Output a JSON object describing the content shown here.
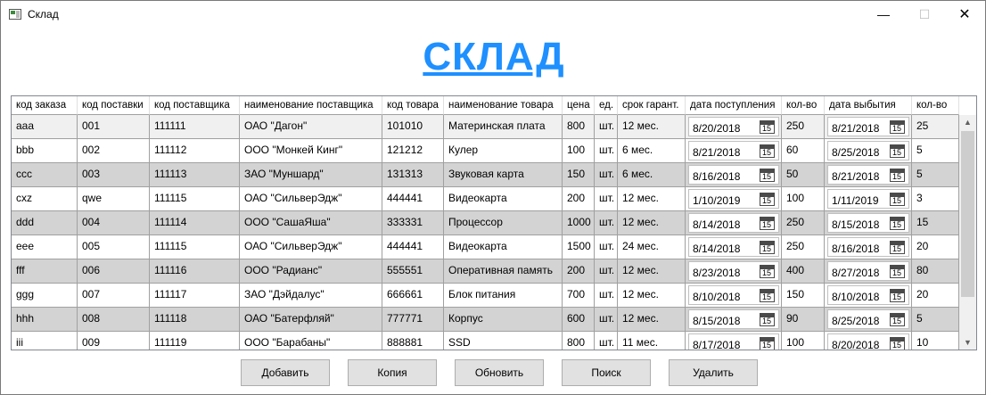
{
  "window": {
    "title": "Склад",
    "minimize_icon": "minimize-icon",
    "maximize_icon": "maximize-icon",
    "close_icon": "close-icon",
    "min_glyph": "—",
    "max_glyph": "☐",
    "close_glyph": "✕"
  },
  "heading": "СКЛАД",
  "grid": {
    "columns": [
      "код заказа",
      "код поставки",
      "код поставщика",
      "наименование поставщика",
      "код товара",
      "наименование товара",
      "цена",
      "ед.",
      "срок гарант.",
      "дата поступления",
      "кол-во",
      "дата выбытия",
      "кол-во"
    ],
    "calendar_icon_text": "15",
    "rows": [
      [
        "aaa",
        "001",
        "111111",
        "ОАО \"Дагон\"",
        "101010",
        "Материнская плата",
        "800",
        "шт.",
        "12 мес.",
        "8/20/2018",
        "250",
        "8/21/2018",
        "25"
      ],
      [
        "bbb",
        "002",
        "111112",
        "ООО \"Монкей Кинг\"",
        "121212",
        "Кулер",
        "100",
        "шт.",
        "6 мес.",
        "8/21/2018",
        "60",
        "8/25/2018",
        "5"
      ],
      [
        "ccc",
        "003",
        "111113",
        "ЗАО \"Муншард\"",
        "131313",
        "Звуковая карта",
        "150",
        "шт.",
        "6 мес.",
        "8/16/2018",
        "50",
        "8/21/2018",
        "5"
      ],
      [
        "cxz",
        "qwe",
        "111115",
        "ОАО \"СильверЭдж\"",
        "444441",
        "Видеокарта",
        "200",
        "шт.",
        "12 мес.",
        "1/10/2019",
        "100",
        "1/11/2019",
        "3"
      ],
      [
        "ddd",
        "004",
        "111114",
        "ООО \"СашаЯша\"",
        "333331",
        "Процессор",
        "1000",
        "шт.",
        "12 мес.",
        "8/14/2018",
        "250",
        "8/15/2018",
        "15"
      ],
      [
        "eee",
        "005",
        "111115",
        "ОАО \"СильверЭдж\"",
        "444441",
        "Видеокарта",
        "1500",
        "шт.",
        "24 мес.",
        "8/14/2018",
        "250",
        "8/16/2018",
        "20"
      ],
      [
        "fff",
        "006",
        "111116",
        "ООО \"Радианс\"",
        "555551",
        "Оперативная память",
        "200",
        "шт.",
        "12 мес.",
        "8/23/2018",
        "400",
        "8/27/2018",
        "80"
      ],
      [
        "ggg",
        "007",
        "111117",
        "ЗАО \"Дэйдалус\"",
        "666661",
        "Блок питания",
        "700",
        "шт.",
        "12 мес.",
        "8/10/2018",
        "150",
        "8/10/2018",
        "20"
      ],
      [
        "hhh",
        "008",
        "111118",
        "ОАО \"Батерфляй\"",
        "777771",
        "Корпус",
        "600",
        "шт.",
        "12 мес.",
        "8/15/2018",
        "90",
        "8/25/2018",
        "5"
      ],
      [
        "iii",
        "009",
        "111119",
        "ООО \"Барабаны\"",
        "888881",
        "SSD",
        "800",
        "шт.",
        "11 мес.",
        "8/17/2018",
        "100",
        "8/20/2018",
        "10"
      ]
    ]
  },
  "scrollbar": {
    "up_glyph": "▲",
    "down_glyph": "▼"
  },
  "buttons": [
    "Добавить",
    "Копия",
    "Обновить",
    "Поиск",
    "Удалить"
  ]
}
